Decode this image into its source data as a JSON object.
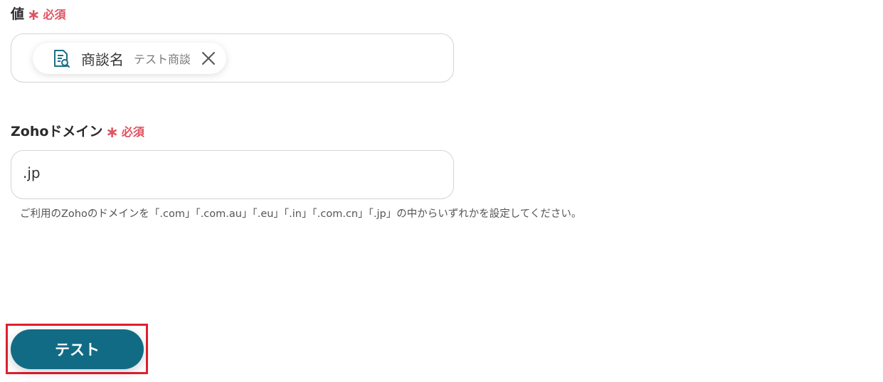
{
  "value_field": {
    "label": "値",
    "required_star": "∗",
    "required_text": "必須",
    "chip": {
      "icon": "document-search-icon",
      "name": "商談名",
      "value": "テスト商談",
      "close_icon": "close-icon"
    }
  },
  "domain_field": {
    "label": "Zohoドメイン",
    "required_star": "∗",
    "required_text": "必須",
    "value": ".jp",
    "help": "ご利用のZohoのドメインを「.com」「.com.au」「.eu」「.in」「.com.cn」「.jp」の中からいずれかを設定してください。"
  },
  "actions": {
    "test_label": "テスト"
  },
  "colors": {
    "required": "#e05260",
    "primary_button": "#126b85",
    "highlight": "#e0202e",
    "chip_icon": "#1a6f86"
  }
}
